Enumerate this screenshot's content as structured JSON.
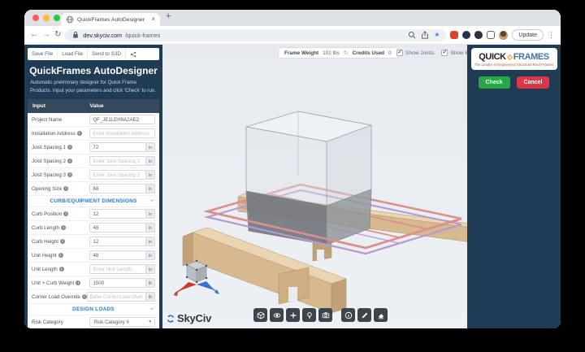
{
  "colors": {
    "navy": "#203c55",
    "header-navy": "#34495e",
    "section-blue": "#2b7cd3",
    "green": "#28a745",
    "red": "#dc3545",
    "logo-orange": "#f6921e",
    "logo-blue": "#44749c",
    "star-blue": "#4285f4",
    "skyciv-blue": "#2a6bd4",
    "wood": "#d6b98f",
    "wood-top": "#e9d5b2",
    "wood-dark": "#c2a178",
    "rail-pink": "#dd8f8e",
    "rail-purple": "#b79bd0"
  },
  "icons": {
    "close": "×",
    "new_tab": "+",
    "back": "←",
    "forward": "→",
    "refresh": "↻",
    "kebab": "⋮",
    "star": "★",
    "collapse": "−",
    "caret": "▾",
    "check": "✓",
    "reload_small": "↻",
    "info": "i"
  },
  "browser": {
    "tab_title": "QuickFrames AutoDesigner",
    "url_host": "dev.skyciv.com",
    "url_path": "/quick-frames",
    "update_label": "Update"
  },
  "sidebar": {
    "toolbar": [
      "Save File",
      "Load File",
      "Send to S3D"
    ],
    "title": "QuickFrames AutoDesigner",
    "subtitle": "Automatic preliminary designer for Quick Frame Products. Input your parameters and click 'Check' to run.",
    "table_header": {
      "input": "Input",
      "value": "Value"
    },
    "rows": [
      {
        "type": "field",
        "label": "Project Name",
        "info": false,
        "value": "QF_JE1LEH9A2AE2"
      },
      {
        "type": "field",
        "label": "Installation Address",
        "info": true,
        "placeholder": "Enter Installation Address"
      },
      {
        "type": "field",
        "label": "Joist Spacing 1",
        "info": true,
        "value": "72",
        "unit": "in"
      },
      {
        "type": "field",
        "label": "Joist Spacing 2",
        "info": true,
        "placeholder": "Enter Joist Spacing 2",
        "unit": "in"
      },
      {
        "type": "field",
        "label": "Joist Spacing 3",
        "info": true,
        "placeholder": "Enter Joist Spacing 3",
        "unit": "in"
      },
      {
        "type": "field",
        "label": "Opening Size",
        "info": true,
        "value": "68",
        "unit": "in"
      },
      {
        "type": "section",
        "label": "CURB/EQUIPMENT DIMENSIONS",
        "collapse": "−"
      },
      {
        "type": "field",
        "label": "Curb Position",
        "info": true,
        "value": "12",
        "unit": "in"
      },
      {
        "type": "field",
        "label": "Curb Length",
        "info": true,
        "value": "48",
        "unit": "in"
      },
      {
        "type": "field",
        "label": "Curb Height",
        "info": true,
        "value": "12",
        "unit": "in"
      },
      {
        "type": "field",
        "label": "Unit Height",
        "info": true,
        "value": "48",
        "unit": "in"
      },
      {
        "type": "field",
        "label": "Unit Length",
        "info": true,
        "placeholder": "Enter Unit Length",
        "unit": "in"
      },
      {
        "type": "field",
        "label": "Unit + Curb Weight",
        "info": true,
        "value": "1500",
        "unit": "lb"
      },
      {
        "type": "field",
        "label": "Corner Load Override",
        "info": true,
        "placeholder": "Enter Corner Load Over",
        "unit": "lb"
      },
      {
        "type": "section",
        "label": "DESIGN LOADS",
        "collapse": "−"
      },
      {
        "type": "field",
        "label": "Risk Category",
        "info": false,
        "control": "select",
        "value": "Risk Category II"
      }
    ]
  },
  "viewport": {
    "stats": {
      "frame_weight_label": "Frame Weight",
      "frame_weight_value": "102 lbs",
      "credits_label": "Credits Used",
      "credits_value": "0"
    },
    "checkboxes": [
      {
        "label": "Show Joists",
        "checked": true
      },
      {
        "label": "Show Equipment",
        "checked": true
      }
    ],
    "tool_groups": [
      [
        "cube-icon",
        "eye-icon",
        "plus-icon",
        "bulb-icon",
        "camera-icon"
      ],
      [
        "info-icon",
        "pencil-icon",
        "eraser-icon"
      ]
    ],
    "brand": "SkyCiv"
  },
  "panel": {
    "logo_quick": "QUICK",
    "logo_frames": "FRAMES",
    "tagline": "The Leader in Engineered Structural Roof Frames",
    "check_label": "Check",
    "cancel_label": "Cancel"
  }
}
